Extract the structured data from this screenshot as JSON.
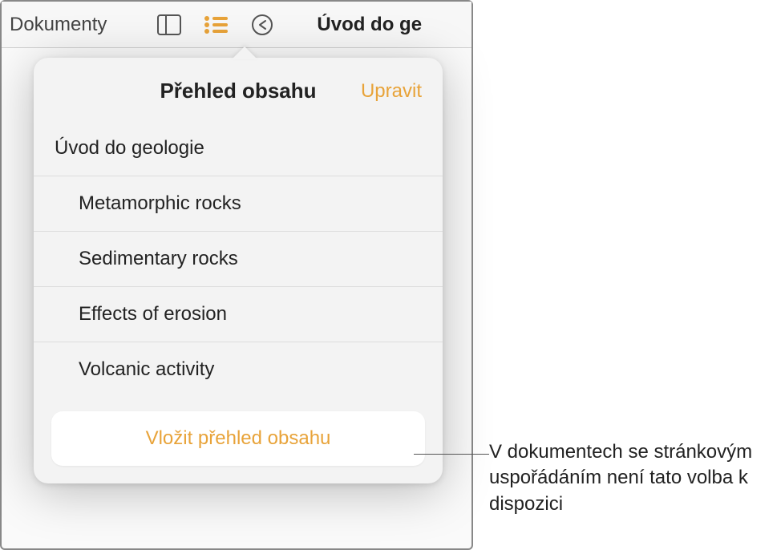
{
  "toolbar": {
    "back_label": "Dokumenty",
    "title": "Úvod do ge"
  },
  "popover": {
    "title": "Přehled obsahu",
    "edit_label": "Upravit",
    "toc": [
      {
        "label": "Úvod do geologie",
        "level": 0
      },
      {
        "label": "Metamorphic rocks",
        "level": 1
      },
      {
        "label": "Sedimentary rocks",
        "level": 1
      },
      {
        "label": "Effects of erosion",
        "level": 1
      },
      {
        "label": "Volcanic activity",
        "level": 1
      }
    ],
    "insert_label": "Vložit přehled obsahu"
  },
  "callout": {
    "text": "V dokumentech se stránkovým uspořádáním není tato volba k dispozici"
  }
}
